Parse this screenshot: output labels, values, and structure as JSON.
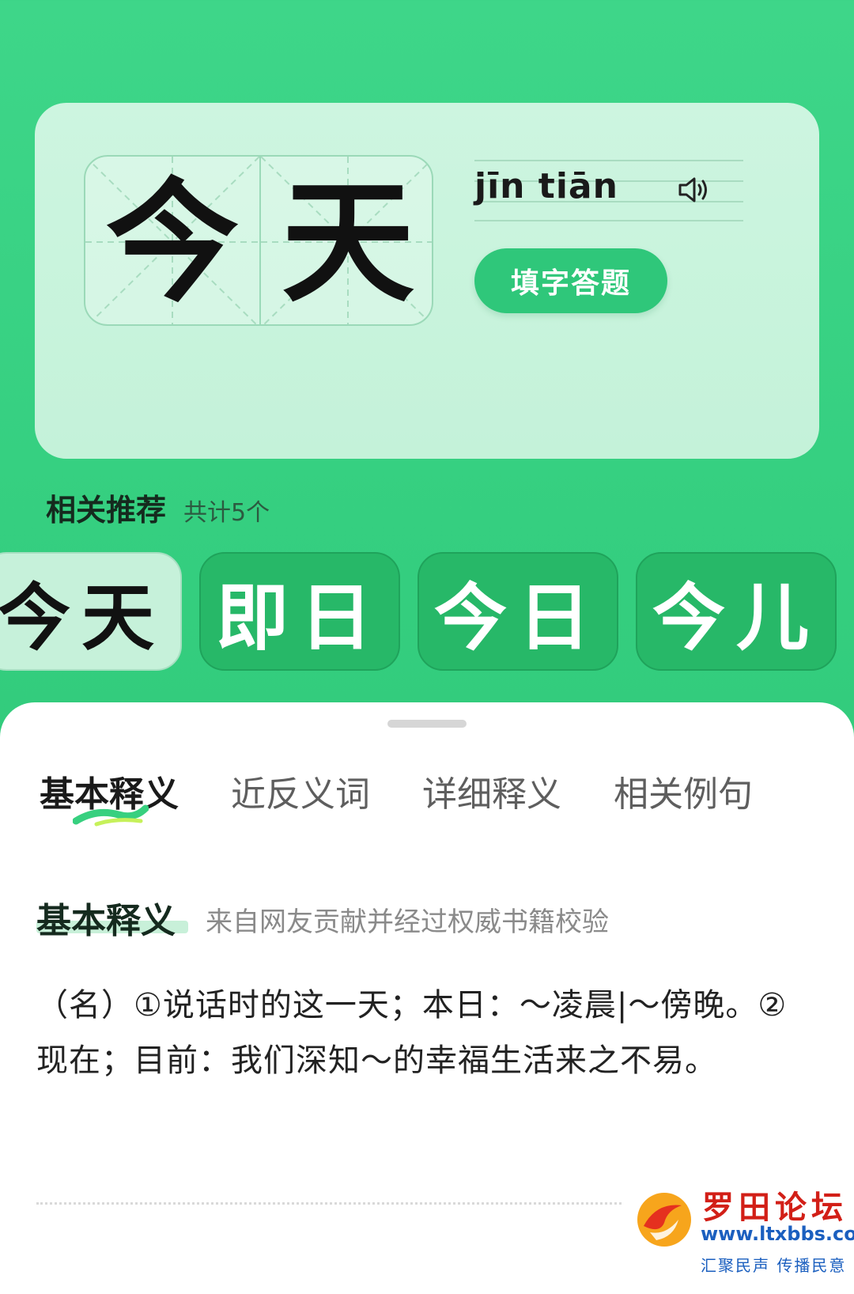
{
  "word": {
    "chars": [
      "今",
      "天"
    ],
    "pinyin": "jīn tiān",
    "quiz_button_label": "填字答题"
  },
  "related": {
    "title": "相关推荐",
    "count": "共计5个",
    "items": [
      "今天",
      "即日",
      "今日",
      "今儿"
    ]
  },
  "tabs": [
    "基本释义",
    "近反义词",
    "详细释义",
    "相关例句"
  ],
  "section": {
    "title": "基本释义",
    "note": "来自网友贡献并经过权威书籍校验",
    "definition": "（名）①说话时的这一天；本日：～凌晨|～傍晚。②现在；目前：我们深知～的幸福生活来之不易。"
  },
  "watermark": {
    "name": "罗田论坛",
    "url": "www.ltxbbs.com",
    "slogan": "汇聚民声 传播民意"
  },
  "colors": {
    "background": "#35cf80",
    "accent": "#2fc77a",
    "card": "#c6f1da"
  }
}
